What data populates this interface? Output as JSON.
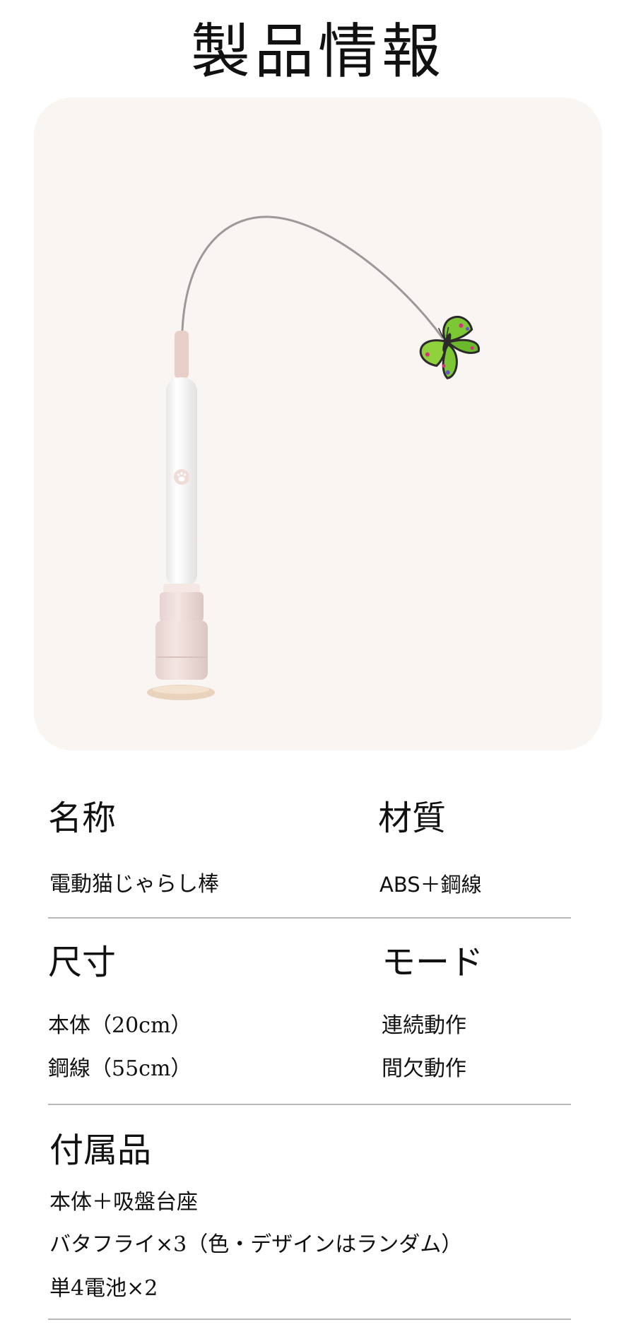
{
  "page_title": "製品情報",
  "product_image": {
    "icons": [
      "paw-icon",
      "butterfly-icon"
    ],
    "colors": {
      "card_background": "#f9f5f2",
      "wand_body": "#ffffff",
      "wand_base": "#efdedb",
      "butterfly_green": "#7cc734",
      "suction_cup": "#ead3bc"
    }
  },
  "specs": {
    "name": {
      "heading": "名称",
      "value": "電動猫じゃらし棒"
    },
    "material": {
      "heading": "材質",
      "value": "ABS＋鋼線"
    },
    "size": {
      "heading": "尺寸",
      "values": [
        "本体（20cm）",
        "鋼線（55cm）"
      ]
    },
    "mode": {
      "heading": "モード",
      "values": [
        "連続動作",
        "間欠動作"
      ]
    },
    "accessories": {
      "heading": "付属品",
      "values": [
        "本体＋吸盤台座",
        "バタフライ×3（色・デザインはランダム）",
        "単4電池×2"
      ]
    }
  }
}
